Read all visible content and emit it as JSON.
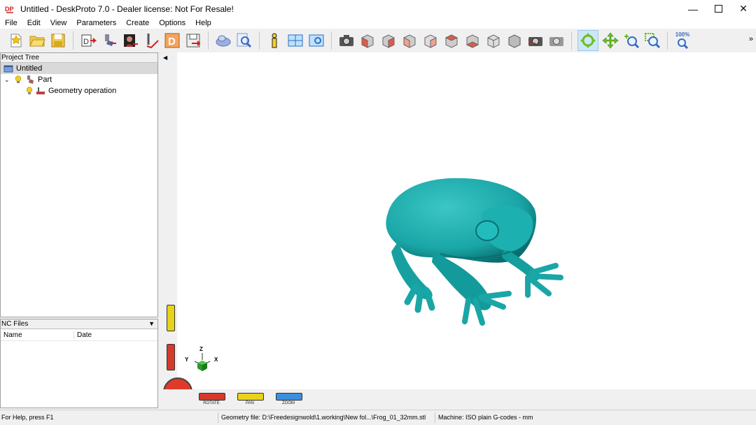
{
  "window": {
    "title": "Untitled - DeskProto 7.0 - Dealer license: Not For Resale!"
  },
  "menu": [
    "File",
    "Edit",
    "View",
    "Parameters",
    "Create",
    "Options",
    "Help"
  ],
  "toolbar": {
    "zoom_label": "100%",
    "icons": [
      "new-file-icon",
      "open-folder-icon",
      "save-icon",
      "import-geometry-icon",
      "part-icon",
      "image-icon",
      "vector-icon",
      "drill-icon",
      "save-nc-icon",
      "operation-icon",
      "preview-icon",
      "info-icon",
      "layout-icon",
      "layout-view-icon",
      "camera-icon",
      "view-front-icon",
      "view-right-icon",
      "view-left-icon",
      "view-back-icon",
      "view-top-icon",
      "view-bottom-icon",
      "view-iso-icon",
      "view-solid-icon",
      "screenshot-icon",
      "refresh-icon",
      "rotate-mode-icon",
      "pan-mode-icon",
      "zoom-in-icon",
      "zoom-window-icon",
      "zoom-100-icon"
    ]
  },
  "project_tree": {
    "header": "Project Tree",
    "items": [
      {
        "label": "Untitled"
      },
      {
        "label": "Part"
      },
      {
        "label": "Geometry operation"
      }
    ]
  },
  "nc_files": {
    "header": "NC Files",
    "columns": [
      "Name",
      "Date"
    ]
  },
  "viewport": {
    "axes": {
      "x": "X",
      "y": "Y",
      "z": "Z"
    },
    "controls": [
      {
        "label": "ROTATE",
        "color": "#d63a2a"
      },
      {
        "label": "PAN",
        "color": "#e8d21a"
      },
      {
        "label": "ZOOM",
        "color": "#3a8fe0"
      }
    ],
    "model_color": "#1aa6a6"
  },
  "status": {
    "help": "For Help, press F1",
    "geometry": "Geometry file: D:\\Freedesignwold\\1.working\\New fol...\\Frog_01_32mm.stl",
    "machine": "Machine: ISO plain G-codes - mm"
  }
}
